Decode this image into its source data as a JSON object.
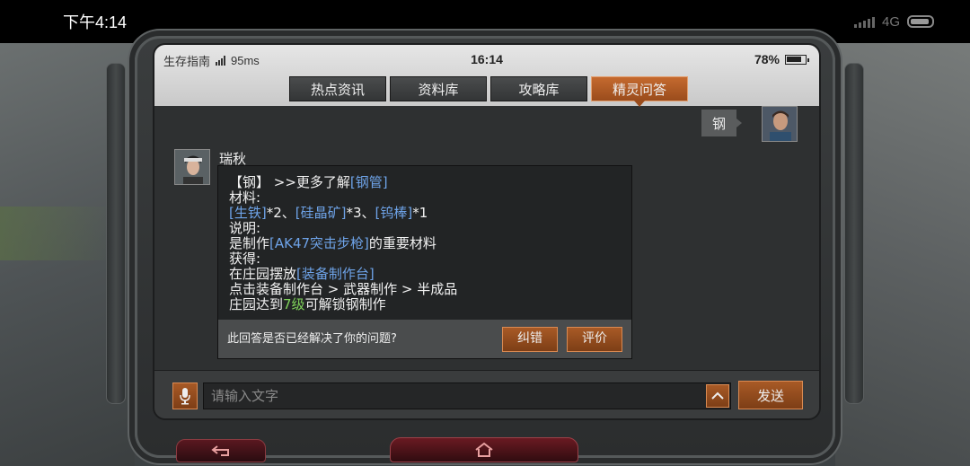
{
  "phone_status": {
    "time": "下午4:14",
    "network": "4G"
  },
  "game_status": {
    "app_name": "生存指南",
    "ping": "95ms",
    "clock": "16:14",
    "battery": "78%"
  },
  "tabs": [
    {
      "label": "热点资讯",
      "active": false
    },
    {
      "label": "资料库",
      "active": false
    },
    {
      "label": "攻略库",
      "active": false
    },
    {
      "label": "精灵问答",
      "active": true
    }
  ],
  "chat": {
    "user_message": "钢",
    "bot_name": "瑞秋",
    "answer": {
      "l1_a": "【钢】 >>更多了解",
      "l1_link": "[钢管]",
      "l2": "材料:",
      "l3_link1": "[生铁]",
      "l3_t1": "*2、",
      "l3_link2": "[硅晶矿]",
      "l3_t2": "*3、",
      "l3_link3": "[钨棒]",
      "l3_t3": "*1",
      "l4": "说明:",
      "l5_a": "是制作",
      "l5_link": "[AK47突击步枪]",
      "l5_b": "的重要材料",
      "l6": "获得:",
      "l7_a": "在庄园摆放",
      "l7_link": "[装备制作台]",
      "l8": "点击装备制作台 > 武器制作 > 半成品",
      "l9_a": "庄园达到",
      "l9_num": "7级",
      "l9_b": "可解锁钢制作"
    },
    "feedback": {
      "question": "此回答是否已经解决了你的问题?",
      "correct_label": "纠错",
      "rate_label": "评价"
    }
  },
  "input": {
    "placeholder": "请输入文字",
    "send_label": "发送"
  },
  "colors": {
    "accent": "#a85a26",
    "link": "#6ea3e8",
    "level": "#7fd35a"
  }
}
